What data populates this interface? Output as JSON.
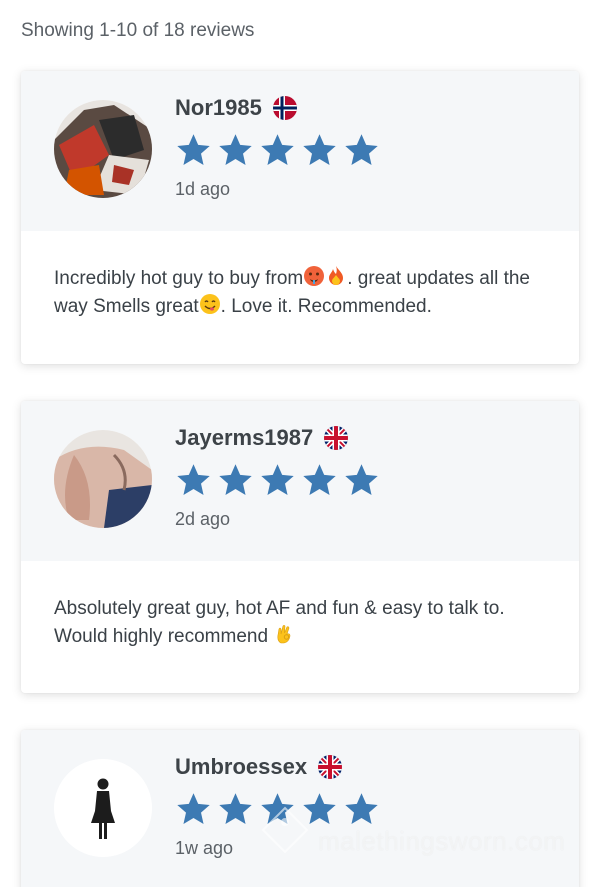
{
  "summary": "Showing 1-10 of 18 reviews",
  "colors": {
    "star": "#3d7ab3",
    "head_bg": "#f5f7f9"
  },
  "reviews": [
    {
      "username": "Nor1985",
      "flag": "norway-flag",
      "rating": 5,
      "time": "1d ago",
      "text_parts": [
        "Incredibly hot guy to buy from",
        ". great updates all the way Smells great",
        ". Love it. Recommended."
      ],
      "emojis": [
        "hot-face-emoji",
        "fire-emoji",
        "yum-face-emoji"
      ]
    },
    {
      "username": "Jayerms1987",
      "flag": "uk-flag",
      "rating": 5,
      "time": "2d ago",
      "text_parts": [
        "Absolutely great guy, hot AF and fun & easy to talk to. Would highly recommend "
      ],
      "emojis": [
        "ok-hand-emoji"
      ]
    },
    {
      "username": "Umbroessex",
      "flag": "uk-flag",
      "rating": 5,
      "time": "1w ago"
    }
  ],
  "watermark": "malethingsworn.com"
}
